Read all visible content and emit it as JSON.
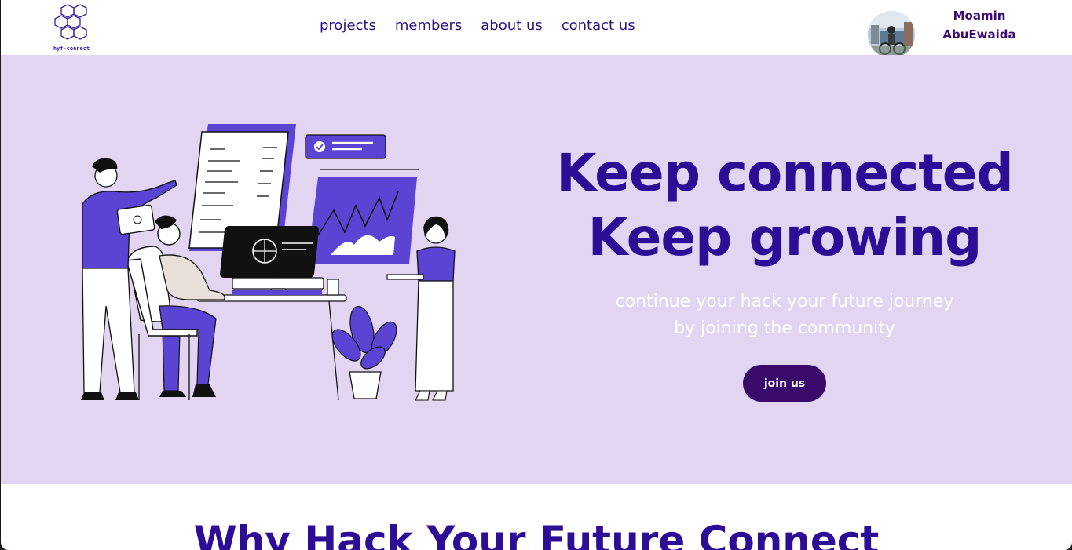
{
  "brand": {
    "logo_text": "hyf-connect",
    "logo_icon": "cubes-logo-icon"
  },
  "nav": {
    "items": [
      {
        "label": "projects"
      },
      {
        "label": "members"
      },
      {
        "label": "about us"
      },
      {
        "label": "contact us"
      }
    ]
  },
  "user": {
    "first_name": "Moamin",
    "last_name": "AbuEwaida",
    "avatar_icon": "user-avatar-photo"
  },
  "hero": {
    "title_line1": "Keep connected",
    "title_line2": "Keep growing",
    "subtitle_line1": "continue your hack your future journey",
    "subtitle_line2": "by joining the community",
    "button_label": "join us",
    "illustration": "team-working-at-computer-illustration"
  },
  "section": {
    "title": "Why Hack Your Future Connect"
  },
  "colors": {
    "primary": "#2e0d96",
    "hero_bg": "#e2d5f2",
    "button_bg": "#3a0a6b",
    "accent_purple": "#5b44d4"
  }
}
